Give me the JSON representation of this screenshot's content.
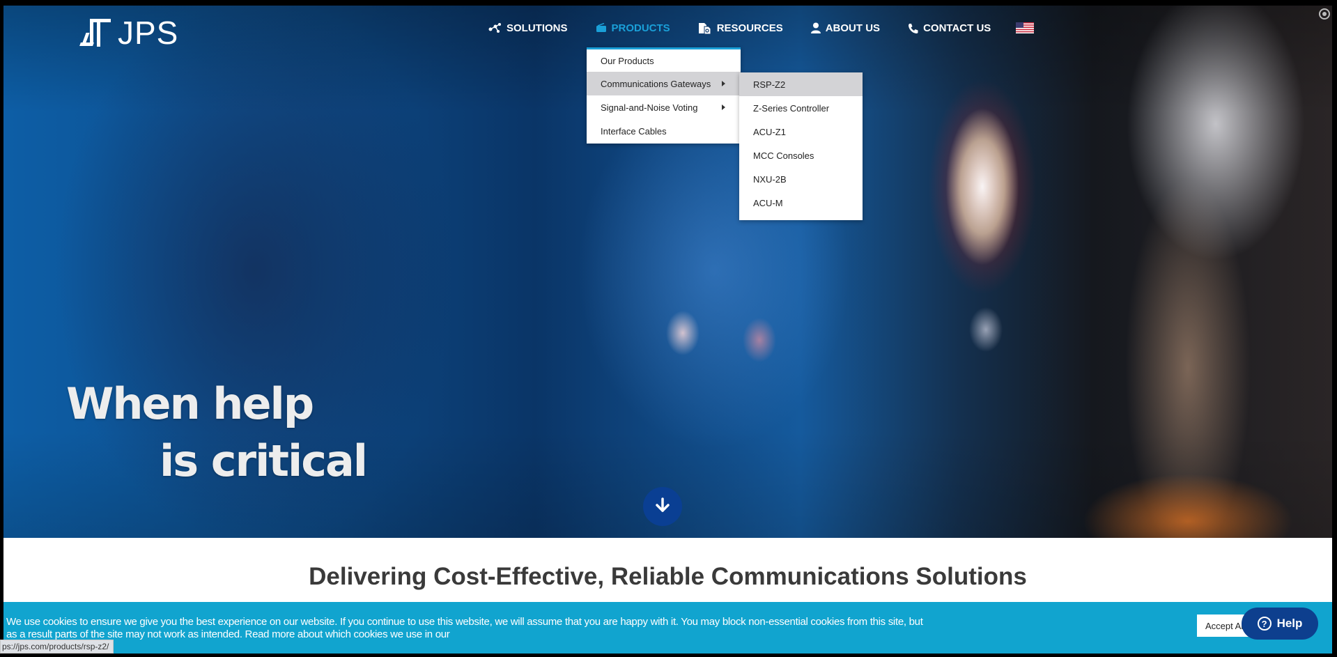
{
  "brand": {
    "logo_text": "JPS"
  },
  "nav": {
    "items": [
      {
        "label": "SOLUTIONS",
        "icon": "network-icon"
      },
      {
        "label": "PRODUCTS",
        "icon": "radio-icon",
        "active": true
      },
      {
        "label": "RESOURCES",
        "icon": "documents-icon"
      },
      {
        "label": "ABOUT US",
        "icon": "user-icon"
      },
      {
        "label": "CONTACT US",
        "icon": "phone-icon"
      }
    ],
    "language_flag": "us-flag-icon"
  },
  "products_menu": {
    "items": [
      {
        "label": "Our Products"
      },
      {
        "label": "Communications Gateways",
        "has_submenu": true,
        "highlighted": true
      },
      {
        "label": "Signal-and-Noise Voting",
        "has_submenu": true
      },
      {
        "label": "Interface Cables"
      }
    ]
  },
  "gateways_submenu": {
    "items": [
      {
        "label": "RSP-Z2",
        "highlighted": true
      },
      {
        "label": "Z-Series Controller"
      },
      {
        "label": "ACU-Z1"
      },
      {
        "label": "MCC Consoles"
      },
      {
        "label": "NXU-2B"
      },
      {
        "label": "ACU-M"
      }
    ]
  },
  "hero": {
    "line1": "When help",
    "line2": "is critical"
  },
  "tagline": "Delivering Cost-Effective, Reliable Communications Solutions",
  "cookie_banner": {
    "text": "We use cookies to ensure we give you the best experience on our website. If you continue to use this website, we will assume that you are happy with it. You may block non-essential cookies from this site, but as a result parts of the site may not work as intended. Read more about which cookies we use in our",
    "accept_label": "Accept All"
  },
  "help_button": {
    "label": "Help"
  },
  "status_bar": {
    "url": "ps://jps.com/products/rsp-z2/"
  },
  "colors": {
    "accent": "#1aa0d8",
    "cookie_bg": "#11a4cf",
    "dark_blue": "#0a3f93"
  }
}
